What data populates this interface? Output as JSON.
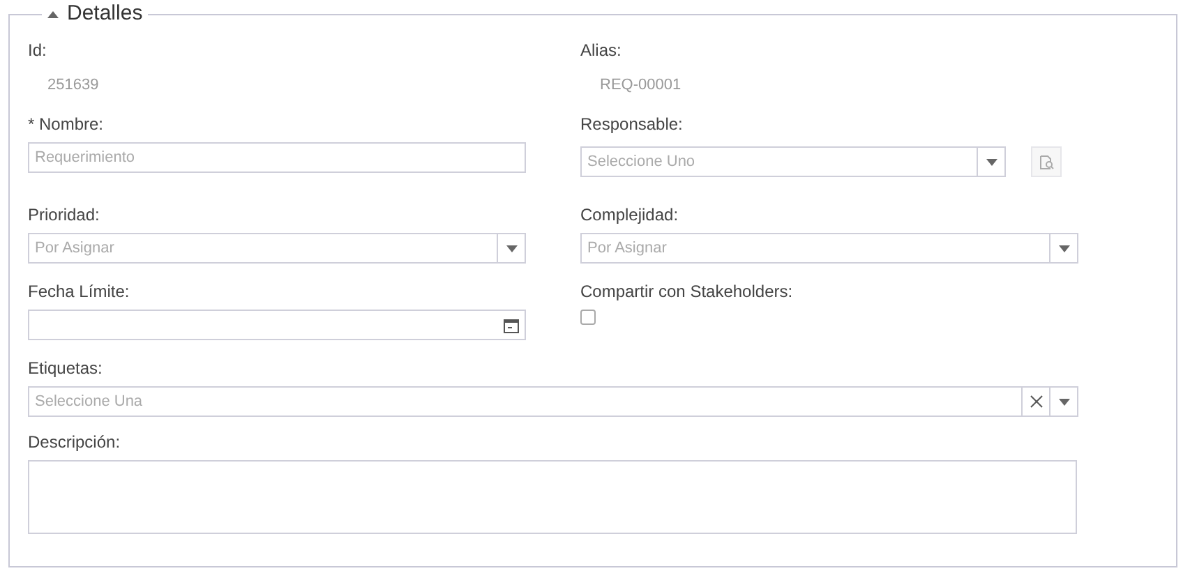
{
  "section": {
    "title": "Detalles",
    "expanded": true
  },
  "rows": [
    [
      {
        "kind": "readonly",
        "label": "Id:",
        "value": "251639"
      },
      {
        "kind": "readonly",
        "label": "Alias:",
        "value": "REQ-00001"
      }
    ],
    [
      {
        "kind": "text",
        "label": "* Nombre:",
        "placeholder": "Requerimiento"
      },
      {
        "kind": "lookup",
        "label": "Responsable:",
        "placeholder": "Seleccione Uno"
      }
    ],
    [
      {
        "kind": "select",
        "label": "Prioridad:",
        "placeholder": "Por Asignar"
      },
      {
        "kind": "select",
        "label": "Complejidad:",
        "placeholder": "Por Asignar"
      }
    ],
    [
      {
        "kind": "date",
        "label": "Fecha Límite:"
      },
      {
        "kind": "checkbox",
        "label": "Compartir con Stakeholders:",
        "checked": false
      }
    ],
    [
      {
        "kind": "tags",
        "label": "Etiquetas:",
        "placeholder": "Seleccione Una"
      }
    ],
    [
      {
        "kind": "textarea",
        "label": "Descripción:"
      }
    ]
  ]
}
